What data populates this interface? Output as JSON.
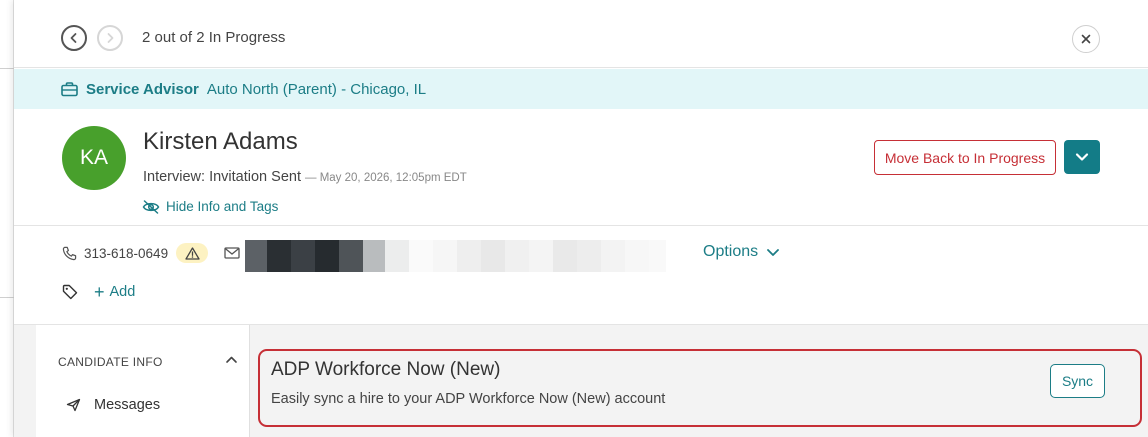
{
  "nav": {
    "counter_text": "2 out of 2 In Progress"
  },
  "job": {
    "title": "Service Advisor",
    "location": "Auto North (Parent) - Chicago, IL"
  },
  "candidate": {
    "initials": "KA",
    "name": "Kirsten Adams",
    "status": "Interview: Invitation Sent",
    "status_date": "— May 20, 2026, 12:05pm EDT",
    "hide_info_label": "Hide Info and Tags",
    "phone": "313-618-0649"
  },
  "actions": {
    "move_back_label": "Move Back to In Progress"
  },
  "contact": {
    "options_label": "Options"
  },
  "tags": {
    "add_label": "Add"
  },
  "sidebar": {
    "section_title": "CANDIDATE INFO",
    "items": [
      {
        "label": "Messages",
        "icon": "send-icon"
      }
    ]
  },
  "integration": {
    "title": "ADP Workforce Now (New)",
    "description": "Easily sync a hire to your ADP Workforce Now (New) account",
    "sync_label": "Sync"
  },
  "colors": {
    "accent": "#1c7d86",
    "danger": "#c62f36",
    "avatar": "#48a02c",
    "banner": "#e2f6f8"
  }
}
